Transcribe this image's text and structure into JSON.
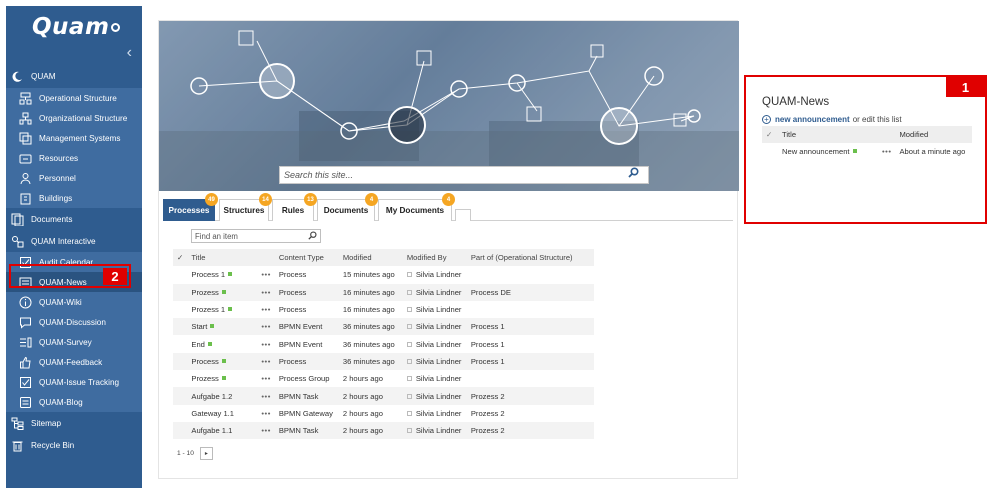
{
  "sidebar": {
    "logo": "Quam",
    "collapse_glyph": "‹",
    "section_label": "QUAM",
    "items": [
      {
        "label": "Operational Structure",
        "icon": "process-structure-icon",
        "sub": true
      },
      {
        "label": "Organizational Structure",
        "icon": "org-chart-icon",
        "sub": true
      },
      {
        "label": "Management Systems",
        "icon": "layers-icon",
        "sub": true
      },
      {
        "label": "Resources",
        "icon": "tools-icon",
        "sub": true
      },
      {
        "label": "Personnel",
        "icon": "people-icon",
        "sub": true
      },
      {
        "label": "Buildings",
        "icon": "building-icon",
        "sub": true
      },
      {
        "label": "Documents",
        "icon": "documents-icon",
        "sub": false
      },
      {
        "label": "QUAM Interactive",
        "icon": "interactive-icon",
        "sub": false
      },
      {
        "label": "Audit Calendar",
        "icon": "checkbox-icon",
        "sub": true
      },
      {
        "label": "QUAM-News",
        "icon": "news-icon",
        "sub": true
      },
      {
        "label": "QUAM-Wiki",
        "icon": "info-icon",
        "sub": true
      },
      {
        "label": "QUAM-Discussion",
        "icon": "chat-icon",
        "sub": true
      },
      {
        "label": "QUAM-Survey",
        "icon": "survey-icon",
        "sub": true
      },
      {
        "label": "QUAM-Feedback",
        "icon": "thumbs-up-icon",
        "sub": true
      },
      {
        "label": "QUAM-Issue Tracking",
        "icon": "checkbox-icon",
        "sub": true
      },
      {
        "label": "QUAM-Blog",
        "icon": "blog-icon",
        "sub": true
      },
      {
        "label": "Sitemap",
        "icon": "sitemap-icon",
        "sub": false
      },
      {
        "label": "Recycle Bin",
        "icon": "trash-icon",
        "sub": false
      }
    ]
  },
  "callouts": {
    "one": "1",
    "two": "2"
  },
  "colors": {
    "sidebar": "#2f5c8f",
    "highlight": "#e00000",
    "badge": "#f5a623",
    "new_marker": "#6bbf4c"
  },
  "search": {
    "placeholder": "Search this site..."
  },
  "tabs": [
    {
      "label": "Processes",
      "count": "49",
      "active": true
    },
    {
      "label": "Structures",
      "count": "14",
      "active": false
    },
    {
      "label": "Rules",
      "count": "13",
      "active": false
    },
    {
      "label": "Documents",
      "count": "4",
      "active": false
    },
    {
      "label": "My Documents",
      "count": "4",
      "active": false
    }
  ],
  "find": {
    "placeholder": "Find an item"
  },
  "grid": {
    "headers": [
      "Title",
      "Content Type",
      "Modified",
      "Modified By",
      "Part of (Operational Structure)"
    ],
    "rows": [
      {
        "title": "Process 1",
        "type": "Process",
        "modified": "15 minutes ago",
        "by": "Silvia Lindner",
        "part": ""
      },
      {
        "title": "Prozess",
        "type": "Process",
        "modified": "16 minutes ago",
        "by": "Silvia Lindner",
        "part": "Process DE"
      },
      {
        "title": "Prozess 1",
        "type": "Process",
        "modified": "16 minutes ago",
        "by": "Silvia Lindner",
        "part": ""
      },
      {
        "title": "Start",
        "type": "BPMN Event",
        "modified": "36 minutes ago",
        "by": "Silvia Lindner",
        "part": "Process 1"
      },
      {
        "title": "End",
        "type": "BPMN Event",
        "modified": "36 minutes ago",
        "by": "Silvia Lindner",
        "part": "Process 1"
      },
      {
        "title": "Process",
        "type": "Process",
        "modified": "36 minutes ago",
        "by": "Silvia Lindner",
        "part": "Process 1"
      },
      {
        "title": "Prozess",
        "type": "Process Group",
        "modified": "2 hours ago",
        "by": "Silvia Lindner",
        "part": ""
      },
      {
        "title": "Aufgabe 1.2",
        "type": "BPMN Task",
        "modified": "2 hours ago",
        "by": "Silvia Lindner",
        "part": "Prozess 2"
      },
      {
        "title": "Gateway 1.1",
        "type": "BPMN Gateway",
        "modified": "2 hours ago",
        "by": "Silvia Lindner",
        "part": "Prozess 2"
      },
      {
        "title": "Aufgabe 1.1",
        "type": "BPMN Task",
        "modified": "2 hours ago",
        "by": "Silvia Lindner",
        "part": "Prozess 2"
      }
    ],
    "new_rows": [
      0,
      1,
      2,
      3,
      4,
      5,
      6
    ],
    "pager": "1 - 10",
    "pager_next": "▸"
  },
  "news": {
    "title": "QUAM-News",
    "new_link": "new announcement",
    "or_edit": "or edit this list",
    "headers": [
      "Title",
      "Modified"
    ],
    "rows": [
      {
        "title": "New announcement",
        "modified": "About a minute ago"
      }
    ]
  }
}
